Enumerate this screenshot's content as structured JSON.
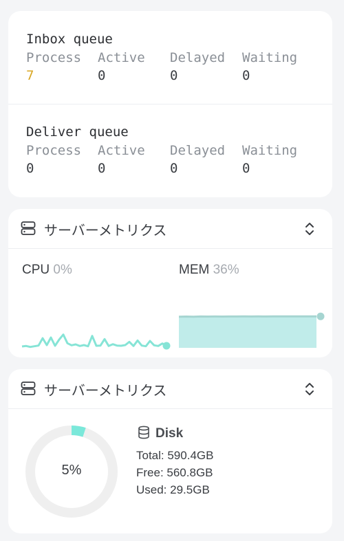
{
  "queues": [
    {
      "title": "Inbox queue",
      "columns": [
        {
          "label": "Process",
          "value": "7",
          "highlight": true
        },
        {
          "label": "Active",
          "value": "0",
          "highlight": false
        },
        {
          "label": "Delayed",
          "value": "0",
          "highlight": false
        },
        {
          "label": "Waiting",
          "value": "0",
          "highlight": false
        }
      ]
    },
    {
      "title": "Deliver queue",
      "columns": [
        {
          "label": "Process",
          "value": "0",
          "highlight": false
        },
        {
          "label": "Active",
          "value": "0",
          "highlight": false
        },
        {
          "label": "Delayed",
          "value": "0",
          "highlight": false
        },
        {
          "label": "Waiting",
          "value": "0",
          "highlight": false
        }
      ]
    }
  ],
  "metrics_card": {
    "title": "サーバーメトリクス",
    "header_icon": "server-icon",
    "toggle_icon": "chevron-updown-icon",
    "cpu": {
      "label": "CPU",
      "percent": "0%"
    },
    "mem": {
      "label": "MEM",
      "percent": "36%"
    }
  },
  "chart_data": [
    {
      "type": "line",
      "series": [
        {
          "name": "CPU",
          "values": [
            0.6,
            0.8,
            0.4,
            0.7,
            1.0,
            4.2,
            1.2,
            4.5,
            0.9,
            3.6,
            5.8,
            2.0,
            1.1,
            1.5,
            0.8,
            1.2,
            0.7,
            5.2,
            0.9,
            1.0,
            3.8,
            0.8,
            1.6,
            1.0,
            0.9,
            1.2,
            2.6,
            0.8,
            3.2,
            1.0,
            0.7,
            3.0,
            1.1,
            0.8,
            1.9,
            0.9
          ]
        }
      ],
      "ylim": [
        0,
        100
      ],
      "color": "#86e4d6"
    },
    {
      "type": "area",
      "series": [
        {
          "name": "MEM",
          "values": [
            35.7,
            35.8,
            35.7,
            35.9,
            35.8,
            35.9,
            35.8,
            35.9,
            35.9,
            36.0,
            35.9,
            36.0,
            35.9,
            36.0,
            36.0,
            36.0,
            36.0,
            36.0,
            36.0,
            36.0
          ]
        }
      ],
      "ylim": [
        0,
        100
      ],
      "color": "#a6d5d1",
      "fill": "#c0ecea"
    }
  ],
  "disk_card": {
    "title": "サーバーメトリクス",
    "header_icon": "server-icon",
    "toggle_icon": "chevron-updown-icon",
    "usage_percent_label": "5%",
    "usage_fraction": 0.05,
    "ring_color": "#7be8da",
    "track_color": "#efefef",
    "heading": "Disk",
    "heading_icon": "database-icon",
    "total": "Total: 590.4GB",
    "free": "Free: 560.8GB",
    "used": "Used: 29.5GB"
  }
}
